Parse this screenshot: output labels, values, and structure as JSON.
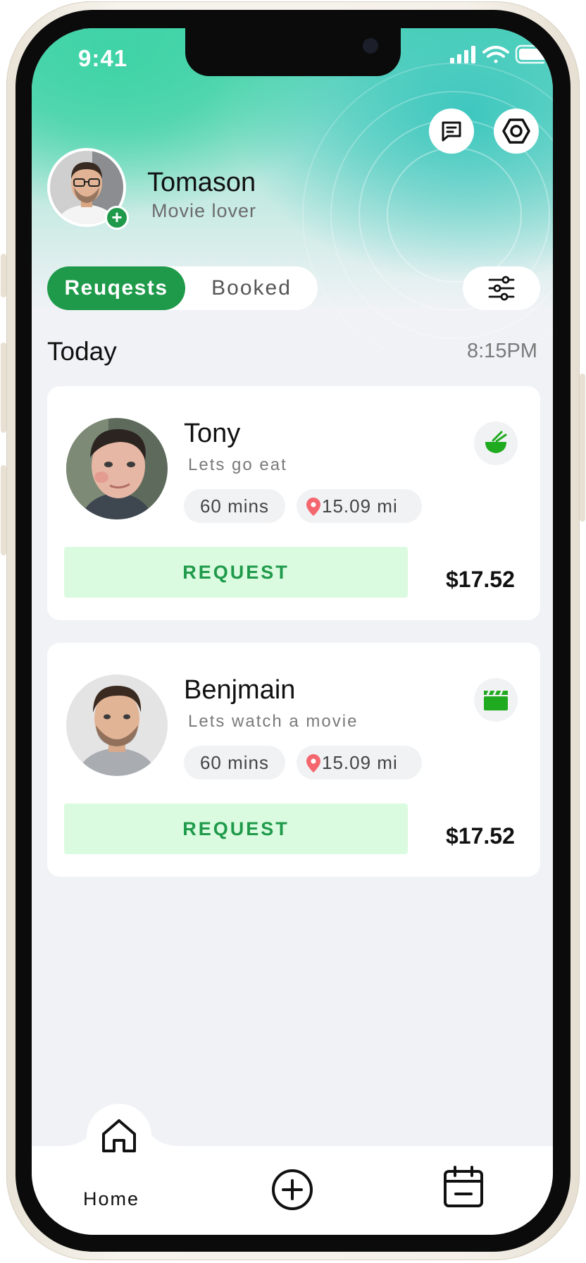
{
  "status_bar": {
    "time": "9:41"
  },
  "profile": {
    "name": "Tomason",
    "subtitle": "Movie lover"
  },
  "tabs": [
    {
      "label": "Reuqests",
      "active": true
    },
    {
      "label": "Booked",
      "active": false
    }
  ],
  "section": {
    "title": "Today",
    "time": "8:15PM"
  },
  "cards": [
    {
      "name": "Tony",
      "message": "Lets go eat",
      "duration": "60 mins",
      "distance": "15.09 mi",
      "category_icon": "bowl-icon",
      "button_label": "REQUEST",
      "price": "$17.52"
    },
    {
      "name": "Benjmain",
      "message": "Lets watch a movie",
      "duration": "60 mins",
      "distance": "15.09 mi",
      "category_icon": "clapperboard-icon",
      "button_label": "REQUEST",
      "price": "$17.52"
    }
  ],
  "bottom_nav": {
    "home_label": "Home"
  },
  "colors": {
    "accent": "#1f9a4b",
    "request_bg": "#dafbdf",
    "pin": "#f4676f"
  }
}
